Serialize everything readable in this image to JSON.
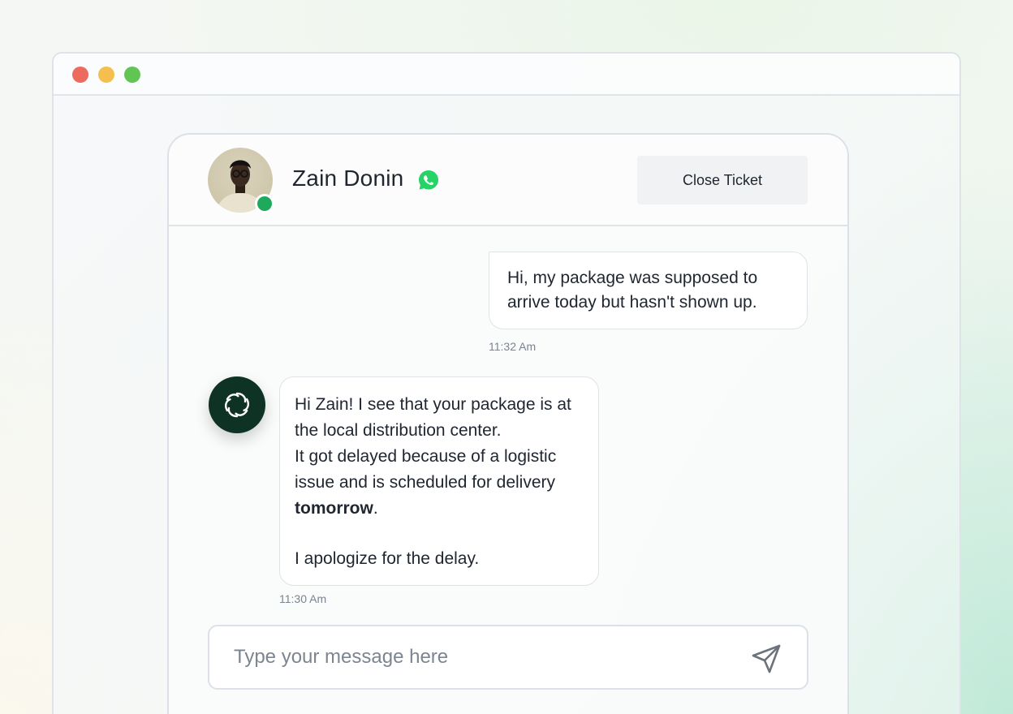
{
  "contact": {
    "name": "Zain Donin",
    "channel_icon": "whatsapp-icon",
    "status": "online"
  },
  "header": {
    "close_ticket_label": "Close Ticket"
  },
  "messages": [
    {
      "sender": "user",
      "text": "Hi, my package was supposed to arrive today but hasn't shown up.",
      "time": "11:32 Am"
    },
    {
      "sender": "bot",
      "line1": "Hi Zain! I see that your package is at the local distribution center.",
      "line2": "It got delayed because of a logistic issue and is scheduled for delivery",
      "bold": "tomorrow",
      "bold_suffix": ".",
      "line3": "I apologize for the delay.",
      "time": "11:30 Am"
    }
  ],
  "composer": {
    "placeholder": "Type your message here"
  },
  "colors": {
    "online": "#1eaa5a",
    "bot_avatar": "#0e3324",
    "whatsapp": "#25d366"
  }
}
